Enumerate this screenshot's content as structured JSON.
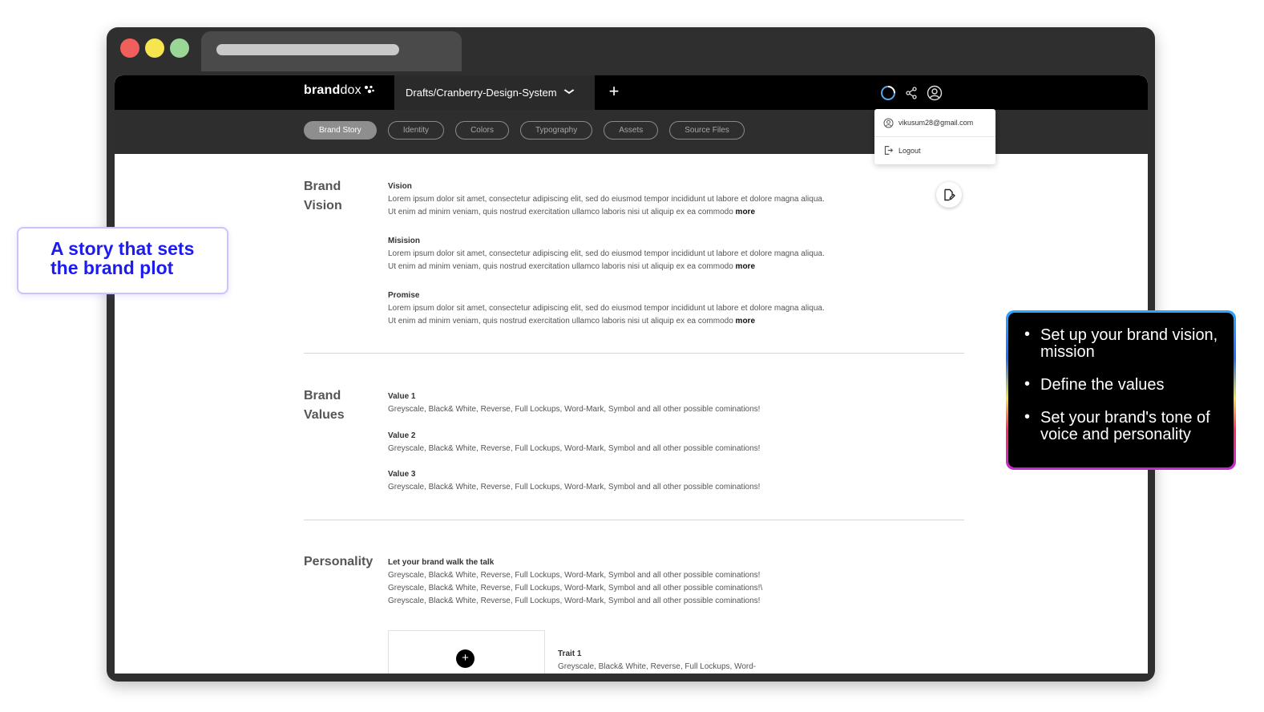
{
  "callouts": {
    "left_text": "A story that sets the brand plot",
    "right_points": [
      "Set up your brand vision, mission",
      "Define the values",
      "Set your brand's tone of voice and personality"
    ]
  },
  "app": {
    "logo_bold": "brand",
    "logo_light": "dox",
    "project_tab": "Drafts/Cranberry-Design-System"
  },
  "nav": {
    "tabs": [
      "Brand Story",
      "Identity",
      "Colors",
      "Typography",
      "Assets",
      "Source Files"
    ],
    "active": "Brand Story"
  },
  "account_menu": {
    "email": "vikusum28@gmail.com",
    "logout": "Logout"
  },
  "brand_vision": {
    "title_line1": "Brand",
    "title_line2": "Vision",
    "items": [
      {
        "title": "Vision",
        "line1": "Lorem ipsum dolor sit amet, consectetur adipiscing elit, sed do eiusmod tempor incididunt ut labore et dolore magna aliqua.",
        "line2": "Ut enim ad minim veniam, quis nostrud exercitation ullamco laboris nisi ut aliquip ex ea commodo",
        "more": "more"
      },
      {
        "title": "Misision",
        "line1": "Lorem ipsum dolor sit amet, consectetur adipiscing elit, sed do eiusmod tempor incididunt ut labore et dolore magna aliqua.",
        "line2": "Ut enim ad minim veniam, quis nostrud exercitation ullamco laboris nisi ut aliquip ex ea commodo",
        "more": "more"
      },
      {
        "title": "Promise",
        "line1": "Lorem ipsum dolor sit amet, consectetur adipiscing elit, sed do eiusmod tempor incididunt ut labore et dolore magna aliqua.",
        "line2": "Ut enim ad minim veniam, quis nostrud exercitation ullamco laboris nisi ut aliquip ex ea commodo",
        "more": "more"
      }
    ]
  },
  "brand_values": {
    "title_line1": "Brand",
    "title_line2": "Values",
    "items": [
      {
        "title": "Value 1",
        "text": "Greyscale, Black& White, Reverse, Full Lockups, Word-Mark, Symbol and all other possible cominations!"
      },
      {
        "title": "Value 2",
        "text": "Greyscale, Black& White, Reverse, Full Lockups, Word-Mark, Symbol and all other possible cominations!"
      },
      {
        "title": "Value 3",
        "text": "Greyscale, Black& White, Reverse, Full Lockups, Word-Mark, Symbol and all other possible cominations!"
      }
    ]
  },
  "personality": {
    "title": "Personality",
    "subtitle": "Let your brand walk the talk",
    "lines": [
      "Greyscale, Black& White, Reverse, Full Lockups, Word-Mark, Symbol and all other possible cominations!",
      "Greyscale, Black& White, Reverse, Full Lockups, Word-Mark, Symbol and all other possible cominations!\\",
      "Greyscale, Black& White, Reverse, Full Lockups, Word-Mark, Symbol and all other possible cominations!"
    ],
    "trait_title": "Trait 1",
    "trait_text": "Greyscale, Black& White, Reverse, Full Lockups, Word-"
  }
}
